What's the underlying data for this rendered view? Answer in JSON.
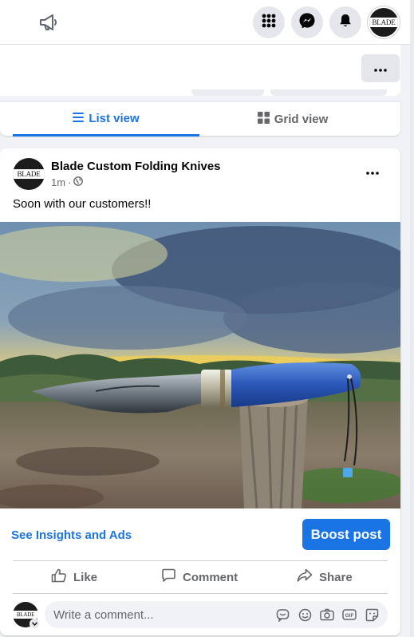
{
  "topbar": {
    "icons": [
      "megaphone-icon",
      "menu-grid-icon",
      "messenger-icon",
      "notifications-bell-icon"
    ],
    "profile_logo_text": "BLADE"
  },
  "toolbar": {
    "more_icon": "more-horizontal-icon"
  },
  "view_tabs": [
    {
      "label": "List view",
      "icon": "list-icon",
      "active": true
    },
    {
      "label": "Grid view",
      "icon": "grid-icon",
      "active": false
    }
  ],
  "post": {
    "author": "Blade Custom Folding Knives",
    "avatar_logo_text": "BLADE",
    "timestamp": "1m",
    "audience_icon": "globe-icon",
    "text": "Soon with our customers!!",
    "photo_description_icon": "post-photo",
    "insights_link": "See Insights and Ads",
    "boost_label": "Boost post",
    "actions": {
      "like": "Like",
      "comment": "Comment",
      "share": "Share"
    },
    "comment_placeholder": "Write a comment...",
    "comment_icons": [
      "avatar-sticker-icon",
      "emoji-icon",
      "camera-icon",
      "gif-icon",
      "sticker-icon"
    ]
  },
  "colors": {
    "accent": "#1b74e4",
    "background": "#f0f2f5",
    "secondary_text": "#65676b"
  }
}
